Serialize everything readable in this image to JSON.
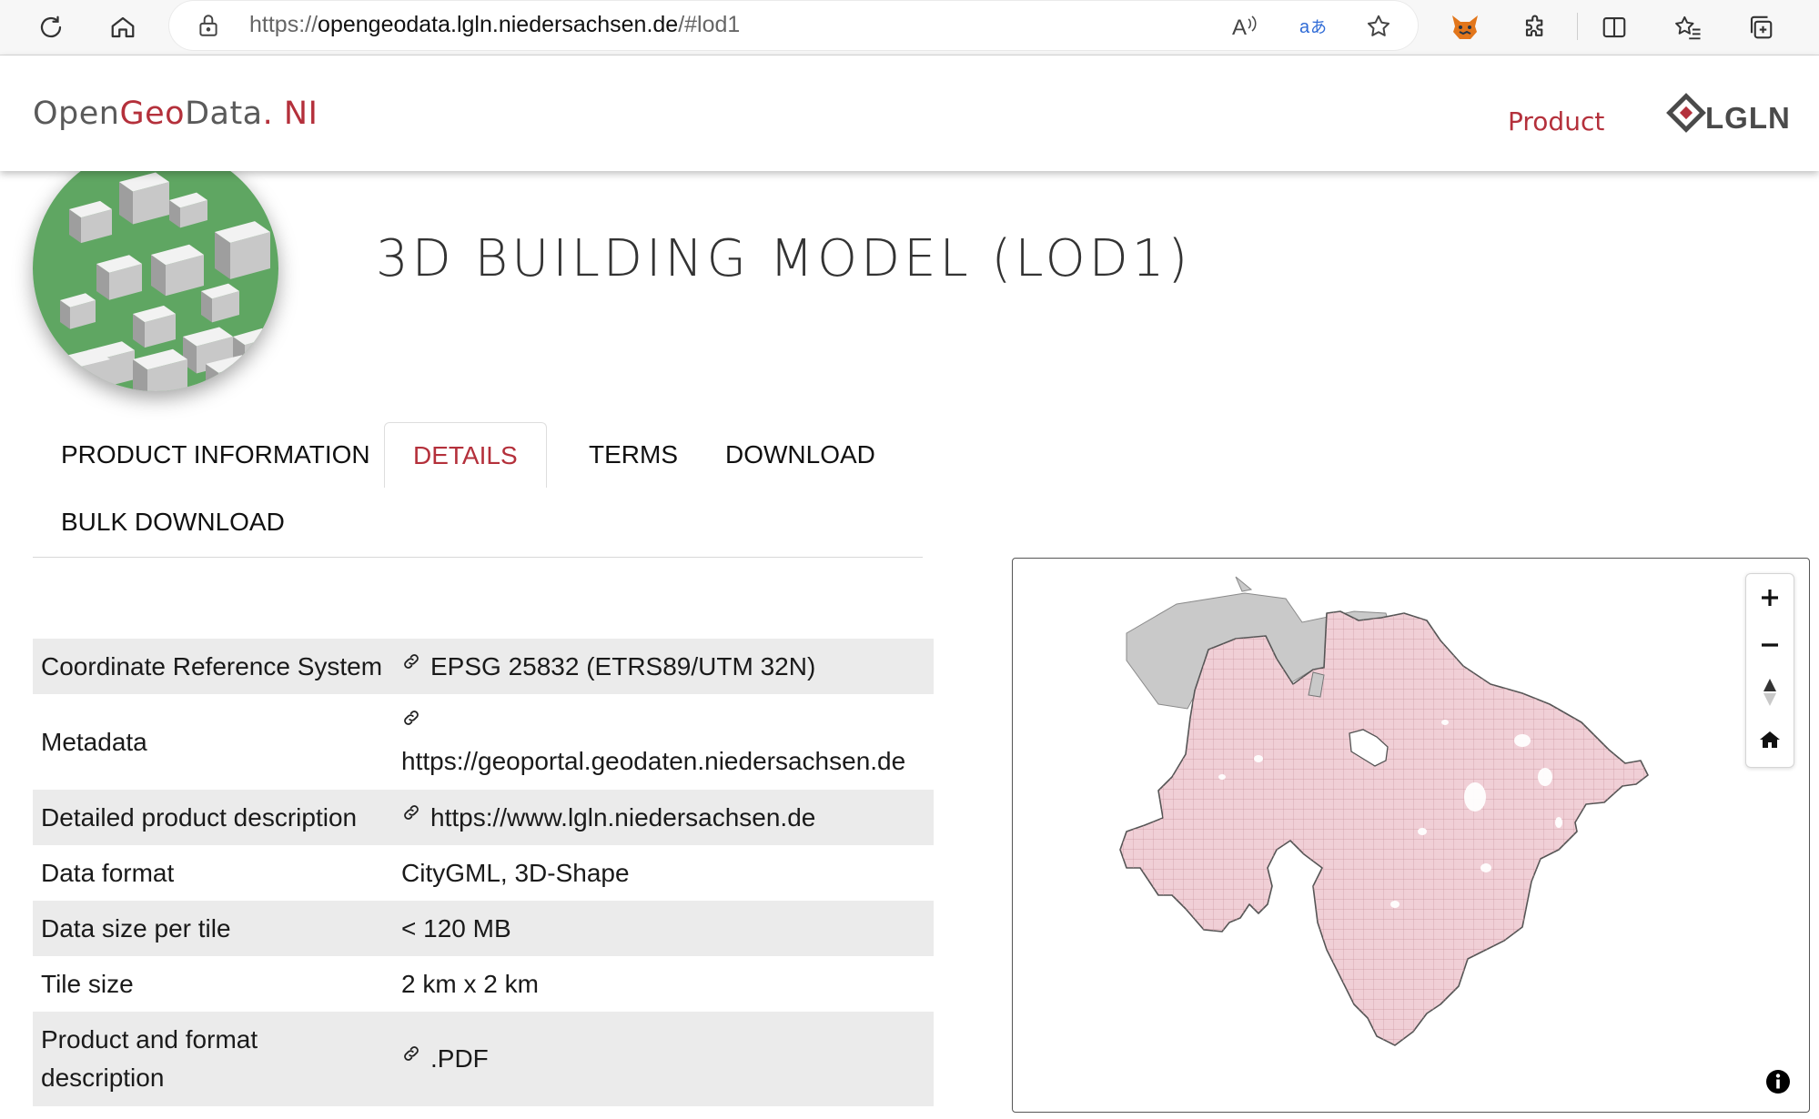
{
  "browser": {
    "url_prefix": "https://",
    "url_host": "opengeodata.lgln.niedersachsen.de",
    "url_path": "/#lod1",
    "icons": [
      "refresh-icon",
      "home-icon",
      "lock-icon",
      "read-aloud-icon",
      "translate-icon",
      "favorite-star-icon",
      "fox-extension-icon",
      "extensions-icon",
      "split-screen-icon",
      "favorites-icon",
      "collections-icon"
    ]
  },
  "header": {
    "logo": {
      "open": "Open",
      "geo": "Geo",
      "data": "Data",
      "dot": ".",
      "ni": " NI"
    },
    "nav_product": "Product",
    "brand_logo_text": "LGLN",
    "accent_color": "#b4303b"
  },
  "product": {
    "title": "3D BUILDING MODEL (LOD1)"
  },
  "tabs": [
    {
      "label": "PRODUCT INFORMATION",
      "active": false
    },
    {
      "label": "DETAILS",
      "active": true
    },
    {
      "label": "TERMS",
      "active": false
    },
    {
      "label": "DOWNLOAD",
      "active": false
    },
    {
      "label": "BULK DOWNLOAD",
      "active": false
    }
  ],
  "details": [
    {
      "label": "Coordinate Reference System",
      "value": "EPSG 25832 (ETRS89/UTM 32N)",
      "link": true
    },
    {
      "label": "Metadata",
      "value": "https://geoportal.geodaten.niedersachsen.de",
      "link": true
    },
    {
      "label": "Detailed product description",
      "value": "https://www.lgln.niedersachsen.de",
      "link": true
    },
    {
      "label": "Data format",
      "value": "CityGML, 3D-Shape",
      "link": false
    },
    {
      "label": "Data size per tile",
      "value": "< 120 MB",
      "link": false
    },
    {
      "label": "Tile size",
      "value": "2 km x 2 km",
      "link": false
    },
    {
      "label": "Product and format description",
      "value": ".PDF",
      "link": true
    }
  ],
  "map": {
    "controls": [
      "zoom-in-icon",
      "zoom-out-icon",
      "compass-icon",
      "home-icon"
    ],
    "fill_color": "#f0cfd6",
    "grid_color": "#cc98a2",
    "outside_color": "#c9c9c9"
  }
}
